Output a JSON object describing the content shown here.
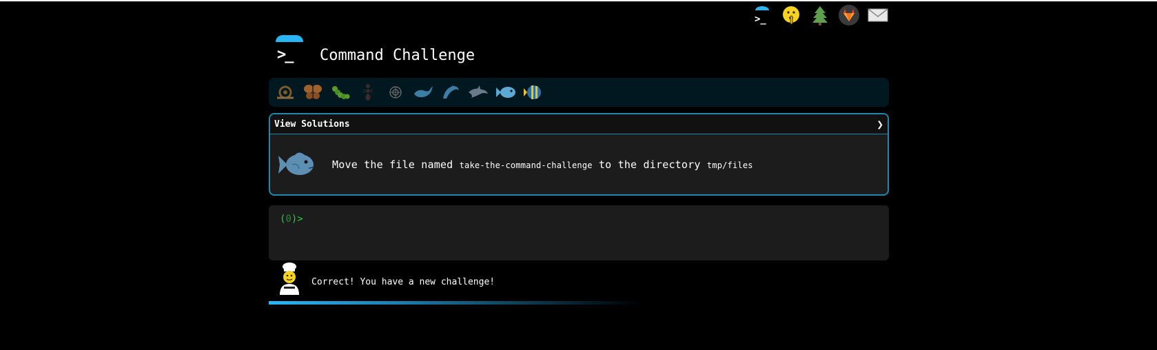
{
  "header": {
    "title": "Command Challenge",
    "logo_prompt": ">_"
  },
  "top_icons": [
    "terminal-icon",
    "shush-emoji-icon",
    "tree-icon",
    "gitlab-icon",
    "mail-icon"
  ],
  "levels": [
    "snail",
    "butterfly",
    "caterpillar",
    "ant",
    "shell",
    "whale",
    "dolphin-jumping",
    "dolphin",
    "fish",
    "tropical-fish"
  ],
  "challenge": {
    "view_solutions_label": "View Solutions",
    "chevron": "❯",
    "text_before": "Move the file named",
    "file_name": "take-the-command-challenge",
    "text_middle": "to the directory",
    "directory": "tmp/files"
  },
  "terminal": {
    "prompt_open": "(",
    "prompt_num": "0",
    "prompt_close": ")>"
  },
  "status": {
    "message": "Correct! You have a new challenge!"
  },
  "colors": {
    "accent": "#29b6f6",
    "panel_border": "#1e88b0",
    "prompt_green": "#2ecc40"
  }
}
